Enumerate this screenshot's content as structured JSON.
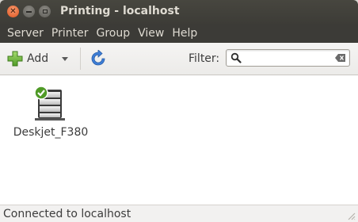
{
  "window": {
    "title": "Printing - localhost"
  },
  "menubar": {
    "items": [
      "Server",
      "Printer",
      "Group",
      "View",
      "Help"
    ]
  },
  "toolbar": {
    "add_label": "Add",
    "filter_label": "Filter:",
    "filter_value": ""
  },
  "printers": [
    {
      "name": "Deskjet_F380",
      "status": "default"
    }
  ],
  "statusbar": {
    "text": "Connected to localhost"
  },
  "colors": {
    "titlebar": "#3c3b37",
    "close": "#e0541f",
    "add_green": "#6dbb2b",
    "refresh_blue": "#3e7ed7",
    "check_green": "#4f9a26"
  }
}
